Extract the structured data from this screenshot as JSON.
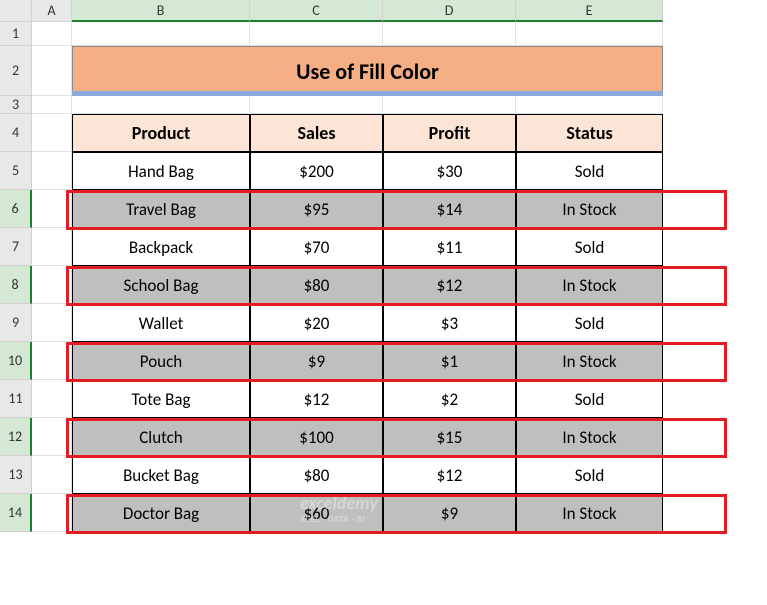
{
  "columns": [
    "",
    "A",
    "B",
    "C",
    "D",
    "E"
  ],
  "rows": [
    "1",
    "2",
    "3",
    "4",
    "5",
    "6",
    "7",
    "8",
    "9",
    "10",
    "11",
    "12",
    "13",
    "14"
  ],
  "selectedRows": [
    6,
    8,
    10,
    12,
    14
  ],
  "title": "Use of Fill Color",
  "headers": {
    "product": "Product",
    "sales": "Sales",
    "profit": "Profit",
    "status": "Status"
  },
  "data": [
    {
      "product": "Hand Bag",
      "sales": "$200",
      "profit": "$30",
      "status": "Sold",
      "highlighted": false
    },
    {
      "product": "Travel Bag",
      "sales": "$95",
      "profit": "$14",
      "status": "In Stock",
      "highlighted": true
    },
    {
      "product": "Backpack",
      "sales": "$70",
      "profit": "$11",
      "status": "Sold",
      "highlighted": false
    },
    {
      "product": "School Bag",
      "sales": "$80",
      "profit": "$12",
      "status": "In Stock",
      "highlighted": true
    },
    {
      "product": "Wallet",
      "sales": "$20",
      "profit": "$3",
      "status": "Sold",
      "highlighted": false
    },
    {
      "product": "Pouch",
      "sales": "$9",
      "profit": "$1",
      "status": "In Stock",
      "highlighted": true
    },
    {
      "product": "Tote Bag",
      "sales": "$12",
      "profit": "$2",
      "status": "Sold",
      "highlighted": false
    },
    {
      "product": "Clutch",
      "sales": "$100",
      "profit": "$15",
      "status": "In Stock",
      "highlighted": true
    },
    {
      "product": "Bucket Bag",
      "sales": "$80",
      "profit": "$12",
      "status": "Sold",
      "highlighted": false
    },
    {
      "product": "Doctor Bag",
      "sales": "$60",
      "profit": "$9",
      "status": "In Stock",
      "highlighted": true
    }
  ],
  "watermark": {
    "main": "exceldemy",
    "sub": "XCEL · DATA · BI"
  }
}
